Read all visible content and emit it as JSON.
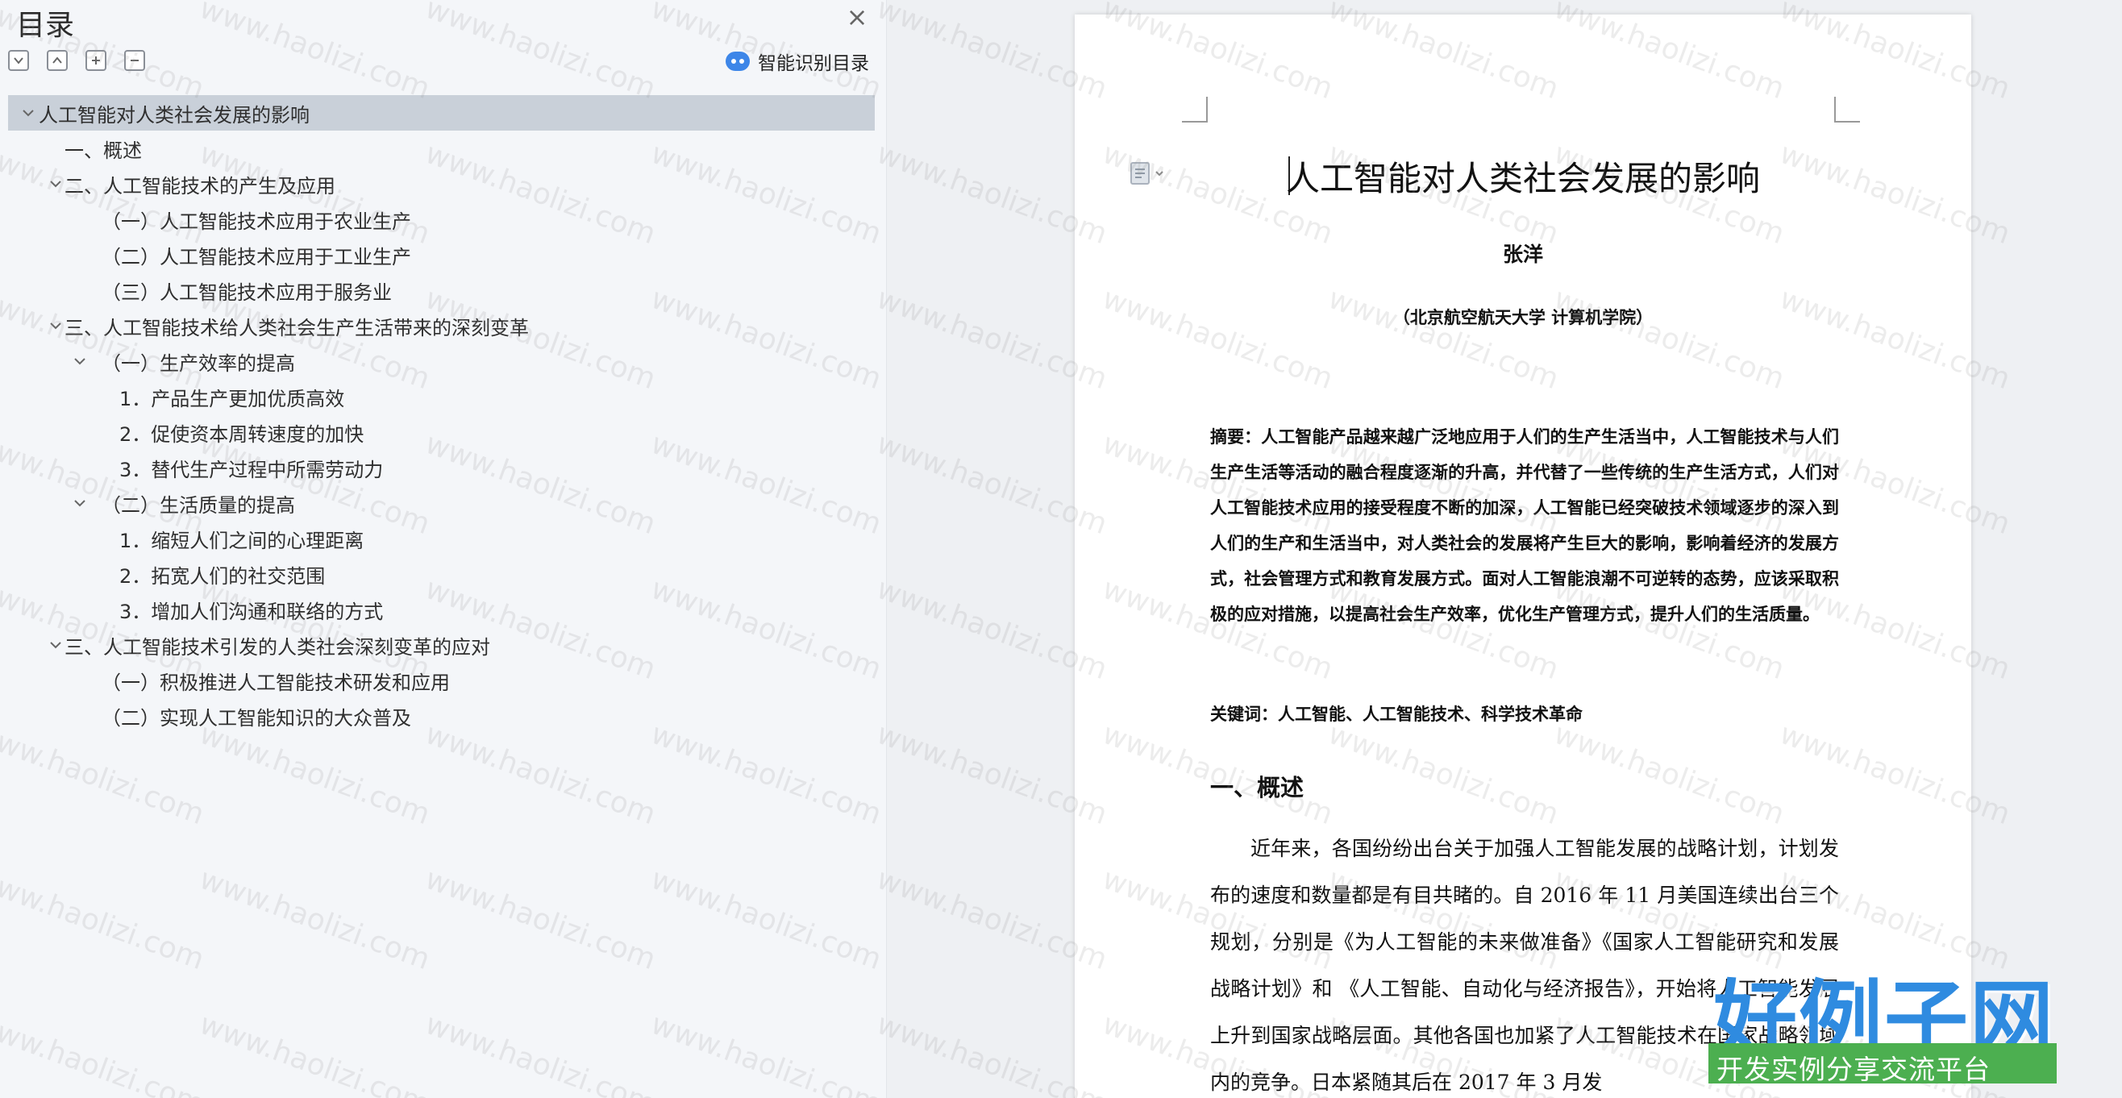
{
  "toc": {
    "title": "目录",
    "smart_toc_label": "智能识别目录",
    "items": [
      {
        "label": "人工智能对人类社会发展的影响",
        "level": 0,
        "expandable": true,
        "selected": true
      },
      {
        "label": "一、概述",
        "level": 1,
        "expandable": false
      },
      {
        "label": "二、人工智能技术的产生及应用",
        "level": 1,
        "expandable": true
      },
      {
        "label": "（一）人工智能技术应用于农业生产",
        "level": 2,
        "expandable": false
      },
      {
        "label": "（二）人工智能技术应用于工业生产",
        "level": 2,
        "expandable": false
      },
      {
        "label": "（三）人工智能技术应用于服务业",
        "level": 2,
        "expandable": false
      },
      {
        "label": "三、人工智能技术给人类社会生产生活带来的深刻变革",
        "level": 1,
        "expandable": true
      },
      {
        "label": "（一）生产效率的提高",
        "level": 2,
        "expandable": true
      },
      {
        "label": "1．产品生产更加优质高效",
        "level": 3,
        "expandable": false
      },
      {
        "label": "2．促使资本周转速度的加快",
        "level": 3,
        "expandable": false
      },
      {
        "label": "3．替代生产过程中所需劳动力",
        "level": 3,
        "expandable": false
      },
      {
        "label": "（二）生活质量的提高",
        "level": 2,
        "expandable": true
      },
      {
        "label": "1．缩短人们之间的心理距离",
        "level": 3,
        "expandable": false
      },
      {
        "label": "2．拓宽人们的社交范围",
        "level": 3,
        "expandable": false
      },
      {
        "label": "3．增加人们沟通和联络的方式",
        "level": 3,
        "expandable": false
      },
      {
        "label": "三、人工智能技术引发的人类社会深刻变革的应对",
        "level": 1,
        "expandable": true
      },
      {
        "label": "（一）积极推进人工智能技术研发和应用",
        "level": 2,
        "expandable": false
      },
      {
        "label": "（二）实现人工智能知识的大众普及",
        "level": 2,
        "expandable": false
      }
    ]
  },
  "document": {
    "title": "人工智能对人类社会发展的影响",
    "author": "张洋",
    "affiliation": "（北京航空航天大学  计算机学院）",
    "abstract": "摘要：人工智能产品越来越广泛地应用于人们的生产生活当中，人工智能技术与人们生产生活等活动的融合程度逐渐的升高，并代替了一些传统的生产生活方式，人们对人工智能技术应用的接受程度不断的加深，人工智能已经突破技术领域逐步的深入到人们的生产和生活当中，对人类社会的发展将产生巨大的影响，影响着经济的发展方式，社会管理方式和教育发展方式。面对人工智能浪潮不可逆转的态势，应该采取积极的应对措施，以提高社会生产效率，优化生产管理方式，提升人们的生活质量。",
    "keywords": "关键词：人工智能、人工智能技术、科学技术革命",
    "heading1": "一、概述",
    "body": "近年来，各国纷纷出台关于加强人工智能发展的战略计划，计划发布的速度和数量都是有目共睹的。自 2016 年 11 月美国连续出台三个规划，分别是《为人工智能的未来做准备》《国家人工智能研究和发展战略计划》和 《人工智能、自动化与经济报告》，开始将人工智能发展上升到国家战略层面。其他各国也加紧了人工智能技术在国家战略领域内的竞争。日本紧随其后在 2017 年 3 月发"
  },
  "watermark": {
    "text": "www.haolizi.com",
    "brand_big": "好例子网",
    "brand_small": "开发实例分享交流平台",
    "brand_color": "#2f8be0",
    "brand_bar_color": "#4caf50"
  },
  "icons": {
    "close": "close-icon",
    "collapse_all": "chevron-down-box-icon",
    "expand_up": "chevron-up-box-icon",
    "plus": "plus-box-icon",
    "minus": "minus-box-icon",
    "smart": "ai-robot-icon",
    "doc": "document-icon"
  }
}
